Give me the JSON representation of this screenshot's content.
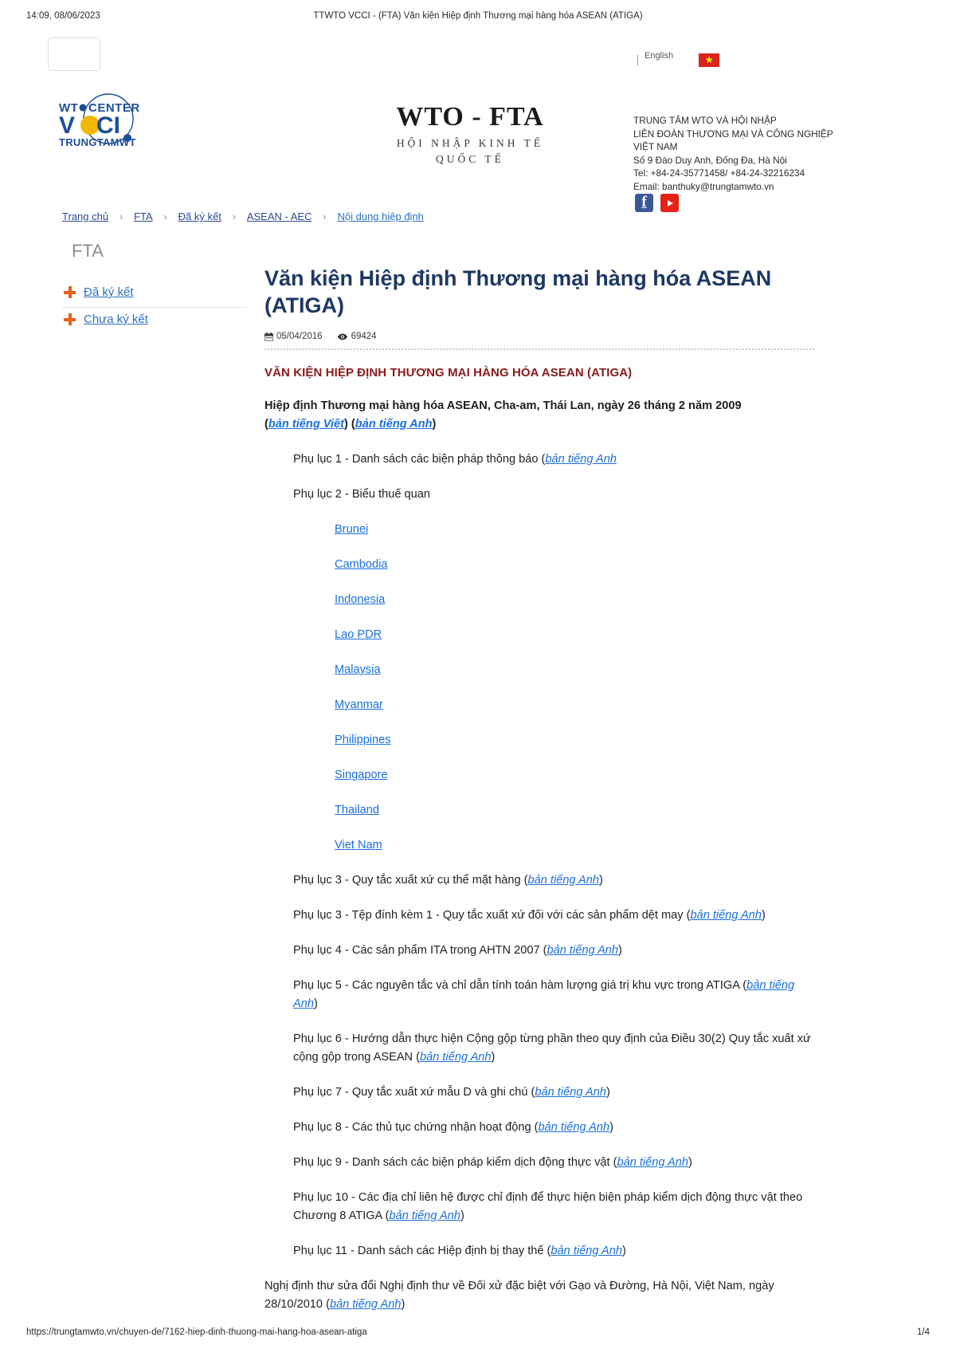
{
  "print": {
    "header_left": "14:09, 08/06/2023",
    "header_center": "TTWTO VCCI - (FTA) Văn kiện Hiệp định Thương mại hàng hóa ASEAN (ATIGA)",
    "footer_url": "https://trungtamwto.vn/chuyen-de/7162-hiep-dinh-thuong-mai-hang-hoa-asean-atiga",
    "footer_page": "1/4"
  },
  "masthead": {
    "logo": {
      "line1": "WTO CENTER",
      "line2": "VCCI",
      "line3": "TRUNGTAMWTO",
      "blue": "#1d4e9c",
      "yellow": "#f2b800"
    },
    "site_title": {
      "main": "WTO - FTA",
      "sub1": "HỘI NHẬP KINH TẾ",
      "sub2": "QUỐC TẾ"
    },
    "language": {
      "label": "English",
      "flag": "vietnam-flag",
      "flag_color": "#da251d",
      "star": "★"
    },
    "contact": {
      "line1": "TRUNG TÂM WTO VÀ HỘI NHẬP",
      "line2": "LIÊN ĐOÀN THƯƠNG MẠI VÀ CÔNG NGHIỆP",
      "line3": "VIỆT NAM",
      "line4": "Số 9 Đào Duy Anh, Đống Đa, Hà Nội",
      "line5": "Tel: +84-24-35771458/ +84-24-32216234",
      "line6": "Email: banthuky@trungtamwto.vn"
    },
    "social": {
      "facebook": "f",
      "youtube": "youtube-icon"
    }
  },
  "breadcrumb": {
    "separator": "›",
    "items": [
      {
        "label": "Trang chủ"
      },
      {
        "label": "FTA"
      },
      {
        "label": "Đã ký kết"
      },
      {
        "label": "ASEAN - AEC"
      },
      {
        "label": "Nội dung hiệp định"
      }
    ]
  },
  "sidebar": {
    "title": "FTA",
    "items": [
      {
        "label": "Đã ký kết",
        "icon": "plus-icon"
      },
      {
        "label": "Chưa ký kết",
        "icon": "plus-icon"
      }
    ]
  },
  "main": {
    "title": "Văn kiện Hiệp định Thương mại hàng hóa ASEAN (ATIGA)",
    "meta": {
      "date": "05/04/2016",
      "views": "69424",
      "date_icon": "calendar-icon",
      "views_icon": "eye-icon"
    },
    "red_heading": "VĂN KIỆN HIỆP ĐỊNH THƯƠNG MẠI HÀNG HÓA ASEAN (ATIGA)",
    "intro": {
      "text": "Hiệp định Thương mại hàng hóa ASEAN, Cha-am, Thái Lan, ngày 26 tháng 2 năm 2009",
      "link_vi": "bản tiếng Việt",
      "link_en": "bản tiếng Anh"
    },
    "link_en_label": "bản tiếng Anh",
    "annex1": {
      "text": "Phụ lục 1 - Danh sách các biện pháp thông báo (",
      "link": "bản tiếng Anh",
      "tail": ")"
    },
    "annex2": {
      "text": "Phụ lục 2 - Biểu thuế quan"
    },
    "countries": [
      {
        "label": "Brunei"
      },
      {
        "label": "Cambodia"
      },
      {
        "label": " Indonesia"
      },
      {
        "label": "Lao PDR "
      },
      {
        "label": "Malaysia"
      },
      {
        "label": "Myanmar"
      },
      {
        "label": "Philippines"
      },
      {
        "label": "Singapore"
      },
      {
        "label": "Thailand"
      },
      {
        "label": "Viet Nam "
      }
    ],
    "annexes": [
      {
        "pre": "Phụ lục 3 - Quy tắc xuất xứ cụ thể mặt hàng (",
        "link": "bản tiếng Anh",
        "post": ")"
      },
      {
        "pre": "Phụ lục 3 - Tệp đính kèm 1 - Quy tắc xuất xứ đối với các sản phẩm dệt may (",
        "link": "bản tiếng Anh",
        "post": ")"
      },
      {
        "pre": "Phụ lục 4 - Các sản phẩm ITA trong AHTN 2007 (",
        "link": "bản tiếng Anh",
        "post": ")"
      },
      {
        "pre": "Phụ lục 5 - Các nguyên tắc và chỉ dẫn tính toán hàm lượng giá trị khu vực trong ATIGA (",
        "link": "bản tiếng Anh",
        "post": ")"
      },
      {
        "pre": "Phụ lục 6 - Hướng dẫn thực hiện Cộng gộp từng phần theo quy định của Điều 30(2) Quy tắc xuất xứ cộng gộp trong ASEAN (",
        "link": "bản tiếng Anh",
        "post": ")"
      },
      {
        "pre": "Phụ lục 7 - Quy tắc xuất xứ mẫu D và ghi chú (",
        "link": "bản tiếng Anh",
        "post": ")"
      },
      {
        "pre": "Phụ lục 8 - Các thủ tục chứng nhận hoạt động (",
        "link": "bản tiếng Anh",
        "post": ")"
      },
      {
        "pre": "Phụ lục 9 - Danh sách các biện pháp kiểm dịch động thực vật (",
        "link": "bản tiếng Anh",
        "post": ")"
      },
      {
        "pre": "Phụ lục 10 - Các địa chỉ liên hệ được chỉ định để thực hiện biện pháp kiểm dịch động thực vật theo Chương 8 ATIGA (",
        "link": "bản tiếng Anh",
        "post": ")"
      },
      {
        "pre": "Phụ lục 11 - Danh sách các Hiệp định bị thay thế (",
        "link": "bản tiếng Anh",
        "post": ")"
      }
    ],
    "final_para": {
      "pre": "Nghị định thư sửa đổi Nghị định thư về Đối xử đặc biệt với Gạo và Đường, Hà Nội, Việt Nam, ngày 28/10/2010 (",
      "link": "bản tiếng Anh",
      "post": ")"
    }
  }
}
